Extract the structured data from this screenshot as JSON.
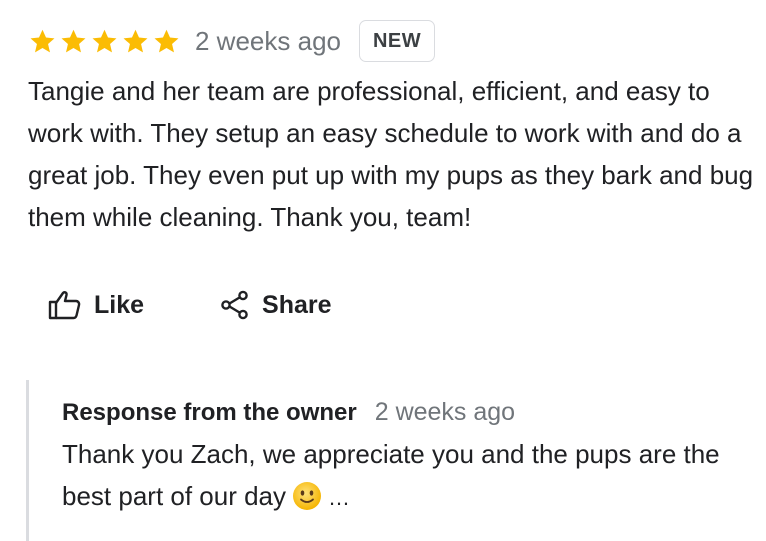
{
  "review": {
    "rating": 5,
    "rating_max": 5,
    "star_color": "#fbbc04",
    "date": "2 weeks ago",
    "badge": "NEW",
    "text": "Tangie and her team are professional, efficient, and easy to work with. They setup an easy schedule to work with and do a great job. They even put up with my pups as they bark and bug them while cleaning. Thank you, team!"
  },
  "actions": {
    "like_label": "Like",
    "like_icon": "thumbs-up-icon",
    "share_label": "Share",
    "share_icon": "share-icon"
  },
  "owner_response": {
    "title": "Response from the owner",
    "date": "2 weeks ago",
    "text": "Thank you Zach, we appreciate you and the pups are the best part of our day",
    "emoji": "slightly-smiling-face",
    "more": "…"
  }
}
